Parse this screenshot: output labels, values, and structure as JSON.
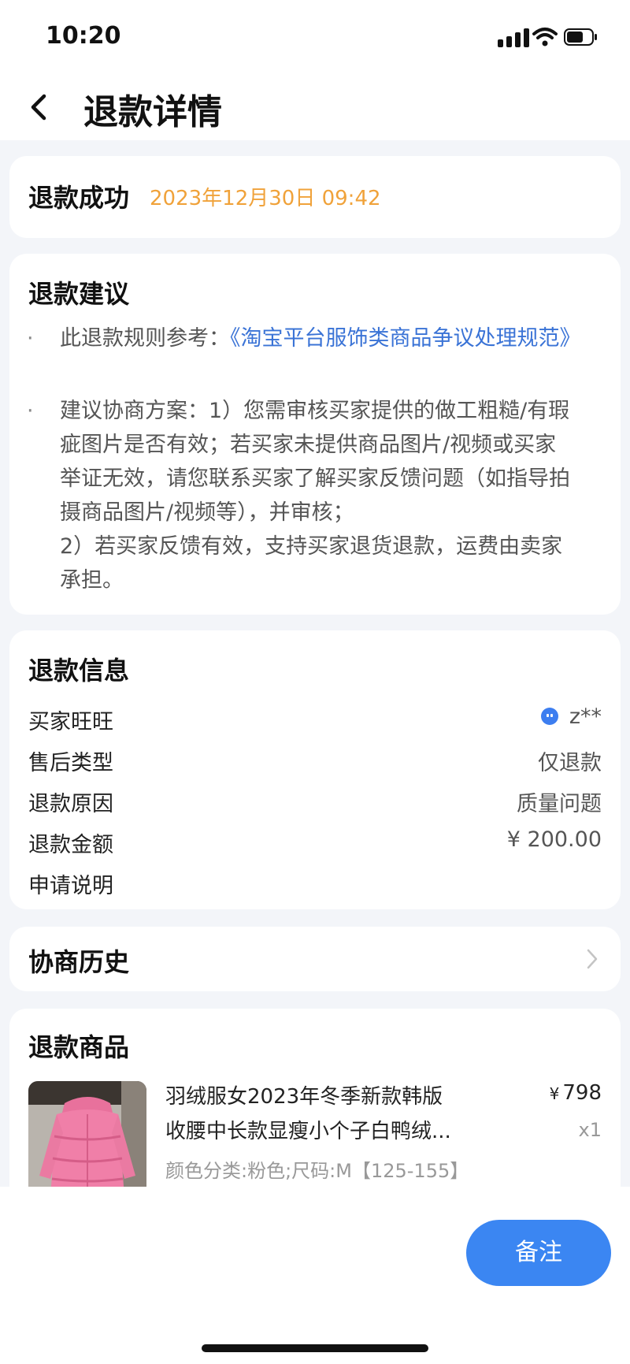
{
  "status_bar": {
    "time": "10:20"
  },
  "header": {
    "title": "退款详情"
  },
  "refund_status": {
    "title": "退款成功",
    "datetime": "2023年12月30日 09:42"
  },
  "advice": {
    "title": "退款建议",
    "bullet": "·",
    "item1_prefix": "此退款规则参考：",
    "item1_link": "《淘宝平台服饰类商品争议处理规范》",
    "item2_lines": [
      "建议协商方案：1）您需审核买家提供的做工粗糙/有瑕",
      "疵图片是否有效；若买家未提供商品图片/视频或买家",
      "举证无效，请您联系买家了解买家反馈问题（如指导拍",
      "摄商品图片/视频等），并审核；",
      "2）若买家反馈有效，支持买家退货退款，运费由卖家",
      "承担。"
    ]
  },
  "refund_info": {
    "title": "退款信息",
    "rows": [
      {
        "label": "买家旺旺",
        "value": "z**"
      },
      {
        "label": "售后类型",
        "value": "仅退款"
      },
      {
        "label": "退款原因",
        "value": "质量问题"
      },
      {
        "label": "退款金额",
        "value": "¥ 200.00"
      },
      {
        "label": "申请说明",
        "value": ""
      }
    ]
  },
  "history": {
    "title": "协商历史"
  },
  "goods": {
    "title": "退款商品",
    "name_line1": "羽绒服女2023年冬季新款韩版",
    "name_line2": "收腰中长款显瘦小个子白鸭绒...",
    "sku": "颜色分类:粉色;尺码:M【125-155】",
    "currency": "¥",
    "price": "798",
    "quantity": "x1"
  },
  "actions": {
    "note_button": "备注"
  },
  "colors": {
    "accent": "#3b86f2",
    "date_orange": "#f0a23a",
    "link_blue": "#3a73d6"
  },
  "icons": [
    "signal-icon",
    "wifi-icon",
    "battery-icon",
    "back-arrow-icon",
    "wangwang-icon",
    "chevron-right-icon"
  ]
}
